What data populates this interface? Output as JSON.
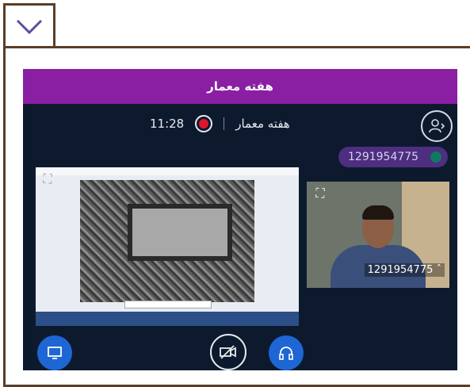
{
  "header": {
    "title": "هفته معمار"
  },
  "session": {
    "name": "هفته معمار",
    "time": "11:28"
  },
  "participant": {
    "id": "1291954775"
  },
  "camera": {
    "label": "1291954775 ˆ"
  },
  "icons": {
    "toggle": "chevron-down-icon",
    "user": "user-switch-icon",
    "expand": "expand-icon",
    "share": "screen-share-icon",
    "camera": "video-off-icon",
    "audio": "headphones-icon"
  },
  "colors": {
    "titlebar": "#8a1fa3",
    "background": "#0d1a2e",
    "accent": "#1e66d4",
    "record": "#e3142a"
  }
}
